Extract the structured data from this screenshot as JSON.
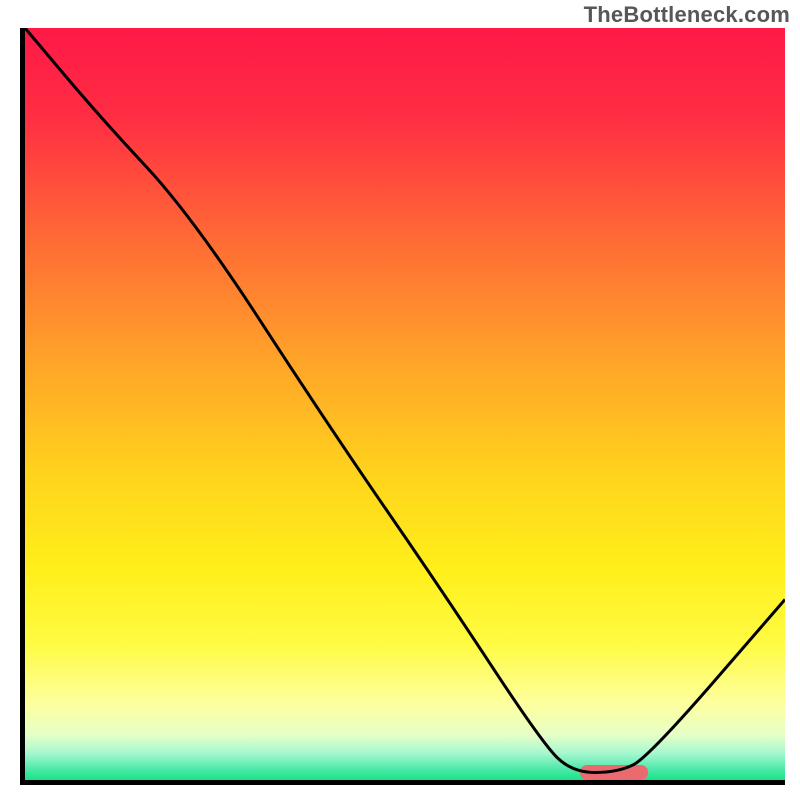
{
  "watermark": "TheBottleneck.com",
  "chart_data": {
    "type": "line",
    "title": "",
    "xlabel": "",
    "ylabel": "",
    "xlim": [
      0,
      100
    ],
    "ylim": [
      0,
      100
    ],
    "gradient_stops": [
      {
        "offset": 0.0,
        "color": "#ff1947"
      },
      {
        "offset": 0.12,
        "color": "#ff2e43"
      },
      {
        "offset": 0.28,
        "color": "#ff6a35"
      },
      {
        "offset": 0.44,
        "color": "#ffa329"
      },
      {
        "offset": 0.6,
        "color": "#ffd51c"
      },
      {
        "offset": 0.72,
        "color": "#ffef1a"
      },
      {
        "offset": 0.82,
        "color": "#fffb44"
      },
      {
        "offset": 0.9,
        "color": "#fdffa0"
      },
      {
        "offset": 0.94,
        "color": "#e6ffc6"
      },
      {
        "offset": 0.965,
        "color": "#a4f7cf"
      },
      {
        "offset": 0.985,
        "color": "#4fe9aa"
      },
      {
        "offset": 1.0,
        "color": "#19e386"
      }
    ],
    "series": [
      {
        "name": "curve",
        "color": "#000000",
        "x": [
          0.0,
          10.0,
          22.0,
          40.0,
          55.0,
          68.0,
          72.0,
          78.0,
          82.0,
          100.0
        ],
        "y": [
          100.0,
          88.0,
          75.0,
          47.0,
          25.0,
          5.0,
          1.0,
          1.0,
          3.0,
          24.0
        ]
      }
    ],
    "marker": {
      "name": "highlight-bar",
      "color": "#ea6a6f",
      "x_start": 73.0,
      "x_end": 82.0,
      "y": 1.0,
      "thickness": 2.0
    }
  }
}
